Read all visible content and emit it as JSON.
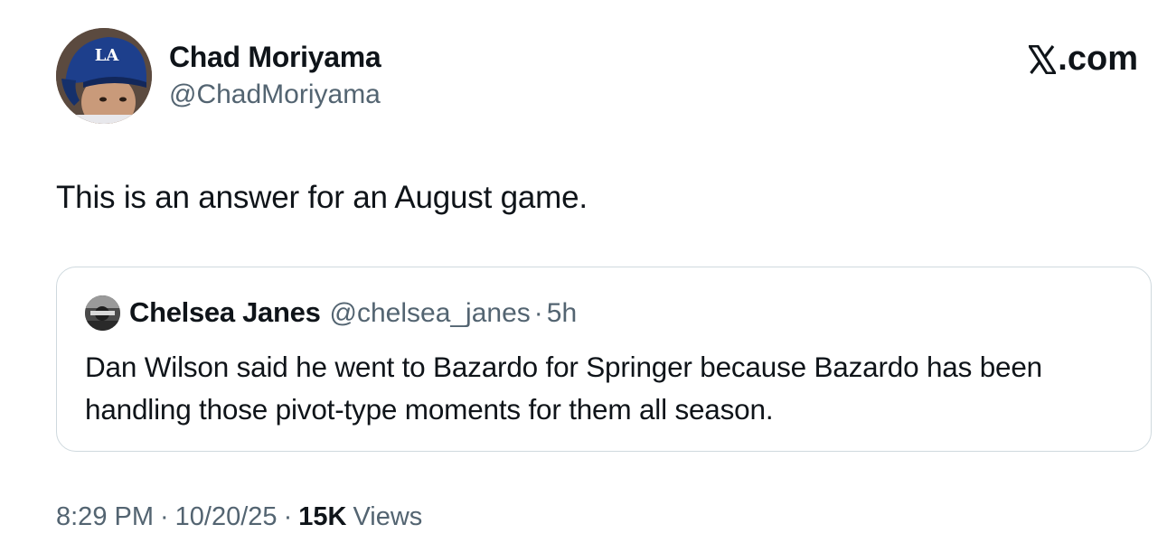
{
  "author": {
    "name": "Chad Moriyama",
    "handle": "@ChadMoriyama",
    "avatar_cap_logo": "LA"
  },
  "brand": {
    "label": ".com",
    "icon": "x-logo-icon"
  },
  "tweet": {
    "text": "This is an answer for an August game."
  },
  "quote": {
    "name": "Chelsea Janes",
    "handle": "@chelsea_janes",
    "separator": "·",
    "time": "5h",
    "text": "Dan Wilson said he went to Bazardo for Springer because Bazardo has been handling those pivot-type moments for them all season."
  },
  "meta": {
    "time": "8:29 PM",
    "separator": "·",
    "date": "10/20/25",
    "views_count": "15K",
    "views_label": "Views"
  },
  "colors": {
    "text_primary": "#0f1419",
    "text_secondary": "#536471",
    "border": "#cfd9de",
    "cap_blue": "#1d3f8c"
  }
}
